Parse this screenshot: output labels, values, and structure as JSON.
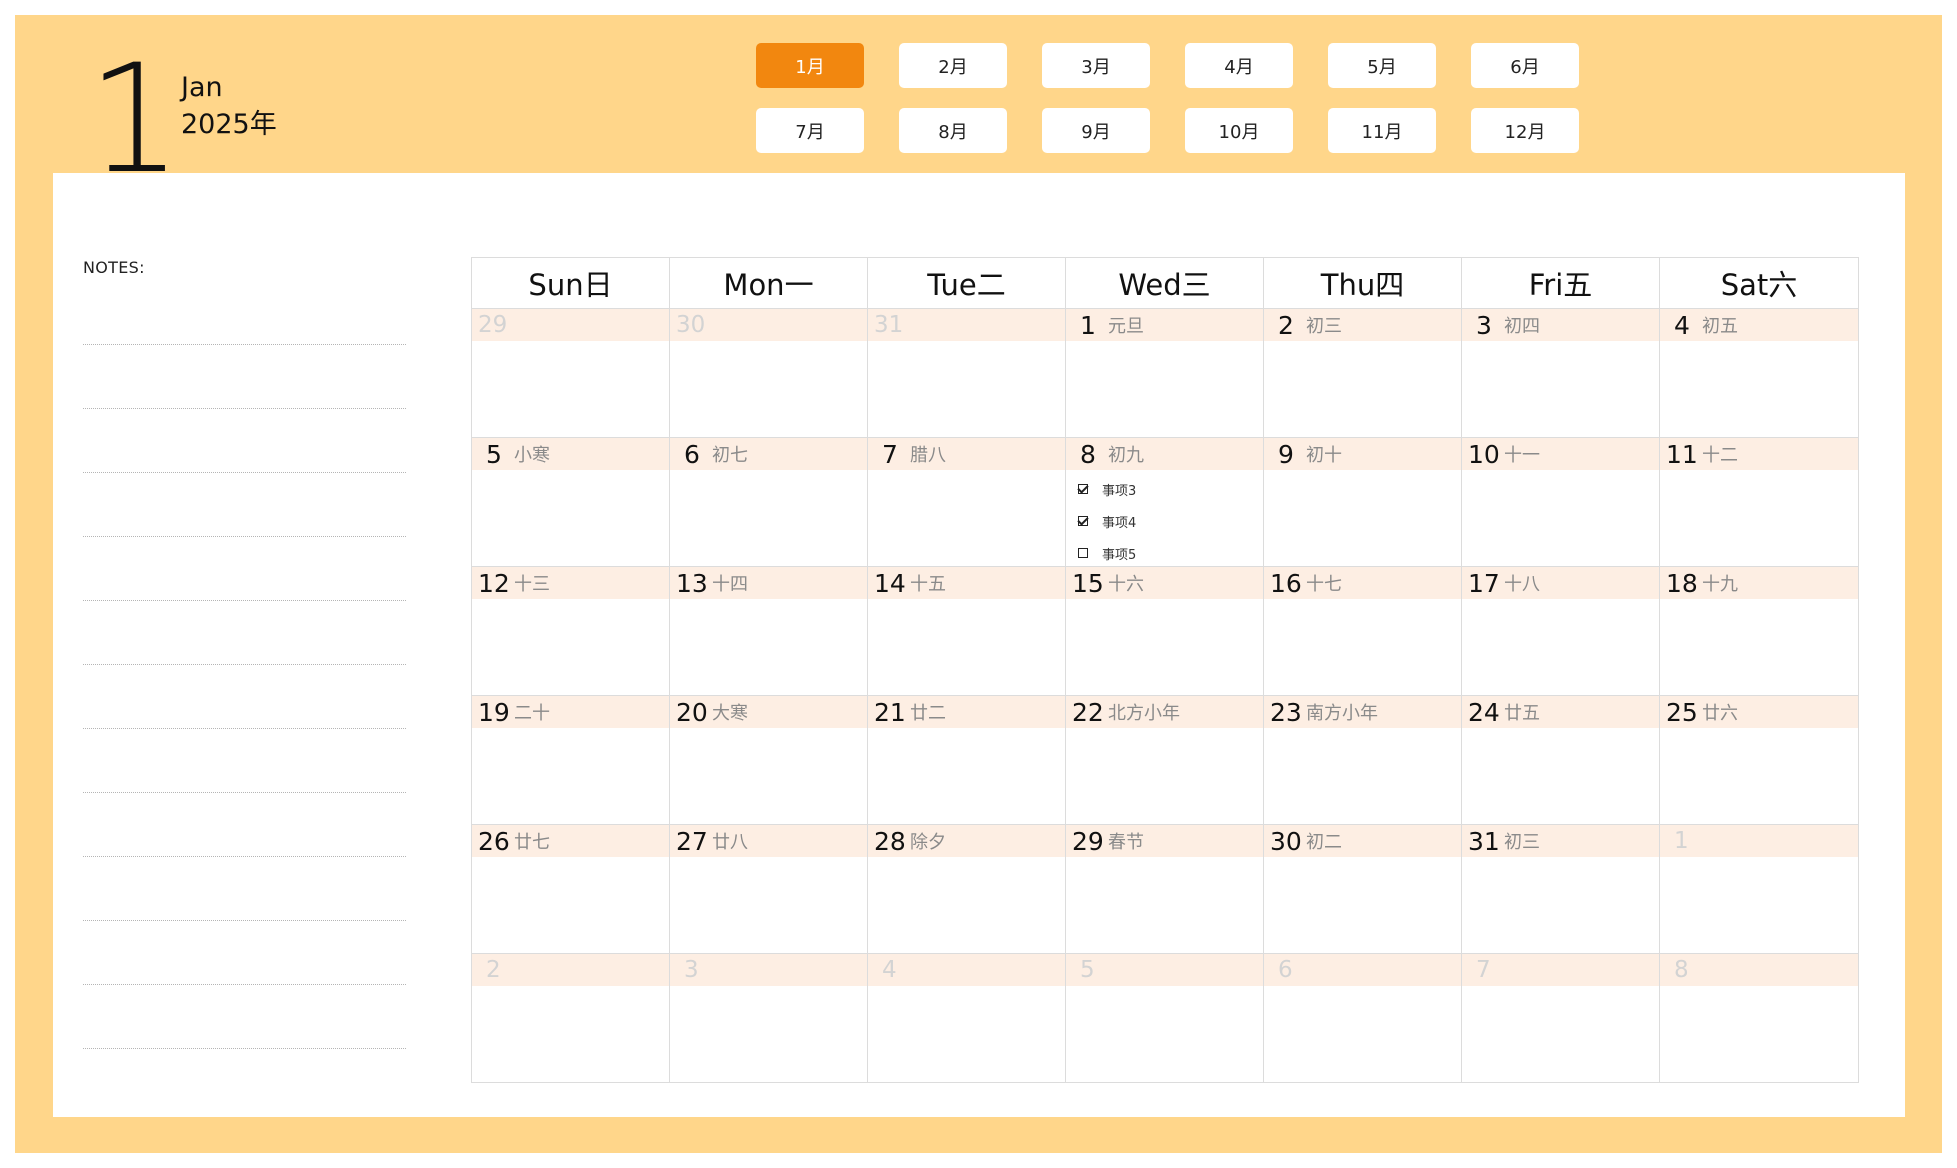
{
  "header": {
    "month_number": "1",
    "month_en": "Jan",
    "year_label": "2025年"
  },
  "month_buttons": [
    "1月",
    "2月",
    "3月",
    "4月",
    "5月",
    "6月",
    "7月",
    "8月",
    "9月",
    "10月",
    "11月",
    "12月"
  ],
  "active_month_index": 0,
  "colors": {
    "frame": "#ffd68a",
    "active_button": "#f2870f",
    "day_header": "#fdeee3"
  },
  "notes": {
    "title": "NOTES:"
  },
  "weekdays": [
    "Sun日",
    "Mon一",
    "Tue二",
    "Wed三",
    "Thu四",
    "Fri五",
    "Sat六"
  ],
  "weeks": [
    [
      {
        "day": "29",
        "lunar": "",
        "other": true
      },
      {
        "day": "30",
        "lunar": "",
        "other": true
      },
      {
        "day": "31",
        "lunar": "",
        "other": true
      },
      {
        "day": "1",
        "lunar": "元旦"
      },
      {
        "day": "2",
        "lunar": "初三"
      },
      {
        "day": "3",
        "lunar": "初四"
      },
      {
        "day": "4",
        "lunar": "初五"
      }
    ],
    [
      {
        "day": "5",
        "lunar": "小寒"
      },
      {
        "day": "6",
        "lunar": "初七"
      },
      {
        "day": "7",
        "lunar": "腊八"
      },
      {
        "day": "8",
        "lunar": "初九",
        "tasks": [
          {
            "label": "事项3",
            "done": true
          },
          {
            "label": "事项4",
            "done": true
          },
          {
            "label": "事项5",
            "done": false
          }
        ]
      },
      {
        "day": "9",
        "lunar": "初十"
      },
      {
        "day": "10",
        "lunar": "十一"
      },
      {
        "day": "11",
        "lunar": "十二"
      }
    ],
    [
      {
        "day": "12",
        "lunar": "十三"
      },
      {
        "day": "13",
        "lunar": "十四"
      },
      {
        "day": "14",
        "lunar": "十五"
      },
      {
        "day": "15",
        "lunar": "十六"
      },
      {
        "day": "16",
        "lunar": "十七"
      },
      {
        "day": "17",
        "lunar": "十八"
      },
      {
        "day": "18",
        "lunar": "十九"
      }
    ],
    [
      {
        "day": "19",
        "lunar": "二十"
      },
      {
        "day": "20",
        "lunar": "大寒"
      },
      {
        "day": "21",
        "lunar": "廿二"
      },
      {
        "day": "22",
        "lunar": "北方小年"
      },
      {
        "day": "23",
        "lunar": "南方小年"
      },
      {
        "day": "24",
        "lunar": "廿五"
      },
      {
        "day": "25",
        "lunar": "廿六"
      }
    ],
    [
      {
        "day": "26",
        "lunar": "廿七"
      },
      {
        "day": "27",
        "lunar": "廿八"
      },
      {
        "day": "28",
        "lunar": "除夕"
      },
      {
        "day": "29",
        "lunar": "春节"
      },
      {
        "day": "30",
        "lunar": "初二"
      },
      {
        "day": "31",
        "lunar": "初三"
      },
      {
        "day": "1",
        "lunar": "",
        "other": true
      }
    ],
    [
      {
        "day": "2",
        "lunar": "",
        "other": true
      },
      {
        "day": "3",
        "lunar": "",
        "other": true
      },
      {
        "day": "4",
        "lunar": "",
        "other": true
      },
      {
        "day": "5",
        "lunar": "",
        "other": true
      },
      {
        "day": "6",
        "lunar": "",
        "other": true
      },
      {
        "day": "7",
        "lunar": "",
        "other": true
      },
      {
        "day": "8",
        "lunar": "",
        "other": true
      }
    ]
  ]
}
